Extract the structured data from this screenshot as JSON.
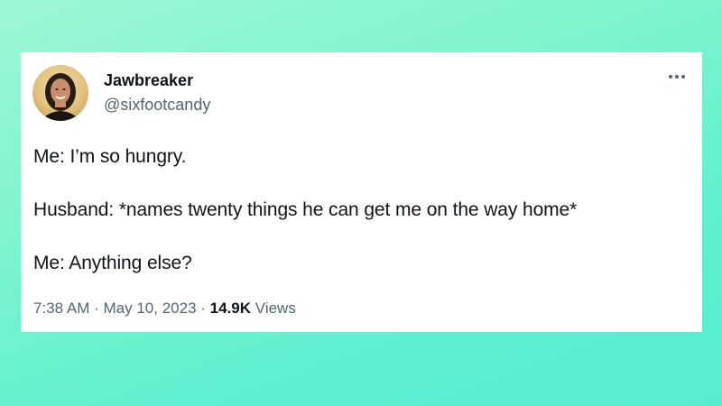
{
  "tweet": {
    "author": {
      "display_name": "Jawbreaker",
      "handle": "@sixfootcandy",
      "avatar_icon": "profile-photo"
    },
    "more_icon": "more-horizontal-icon",
    "lines": [
      "Me: I’m so hungry.",
      "Husband: *names twenty things he can get me on the way home*",
      "Me: Anything else?"
    ],
    "time": "7:38 AM",
    "separator": "·",
    "date": "May 10, 2023",
    "views_count": "14.9K",
    "views_label": "Views"
  },
  "colors": {
    "text_primary": "#0f1419",
    "text_secondary": "#536471",
    "card_background": "#ffffff",
    "page_background": "#5ef0cf"
  }
}
